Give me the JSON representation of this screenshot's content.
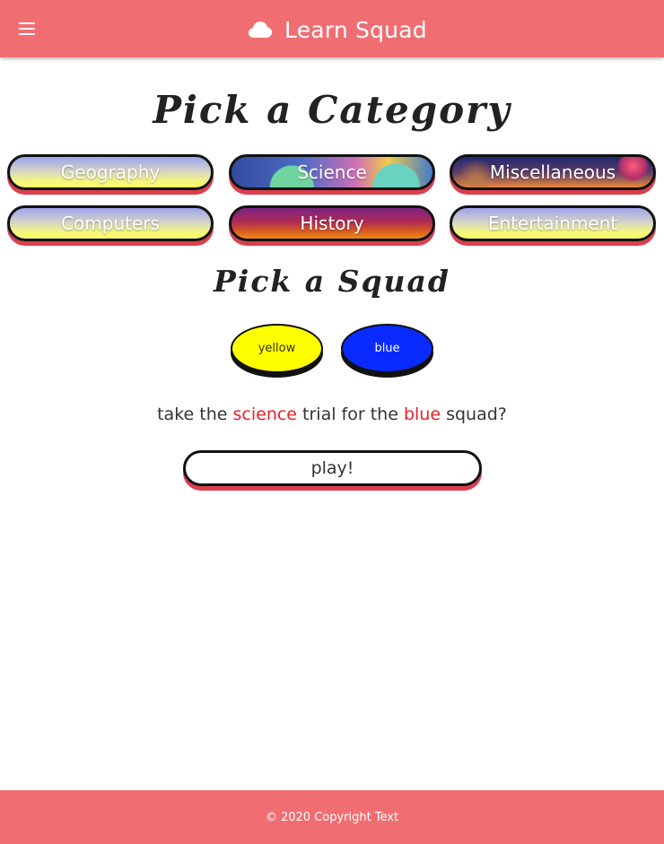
{
  "navbar": {
    "menu_icon": "hamburger-menu-icon",
    "brand_icon": "cloud-icon",
    "title": "Learn Squad",
    "color": "#f06e72"
  },
  "category_section": {
    "heading": "Pick a Category",
    "categories": [
      {
        "label": "Geography"
      },
      {
        "label": "Science"
      },
      {
        "label": "Miscellaneous"
      },
      {
        "label": "Computers"
      },
      {
        "label": "History"
      },
      {
        "label": "Entertainment"
      }
    ]
  },
  "squad_section": {
    "heading": "Pick a Squad",
    "squads": [
      {
        "label": "yellow",
        "color": "#ffff00"
      },
      {
        "label": "blue",
        "color": "#0a2bff"
      }
    ]
  },
  "confirmation": {
    "part1": "take the",
    "category": "science",
    "part2": "trial for the",
    "squad": "blue",
    "part3": "squad?",
    "highlight_color": "#e8202a"
  },
  "play_button": {
    "label": "play!"
  },
  "footer": {
    "text": "© 2020 Copyright Text"
  }
}
